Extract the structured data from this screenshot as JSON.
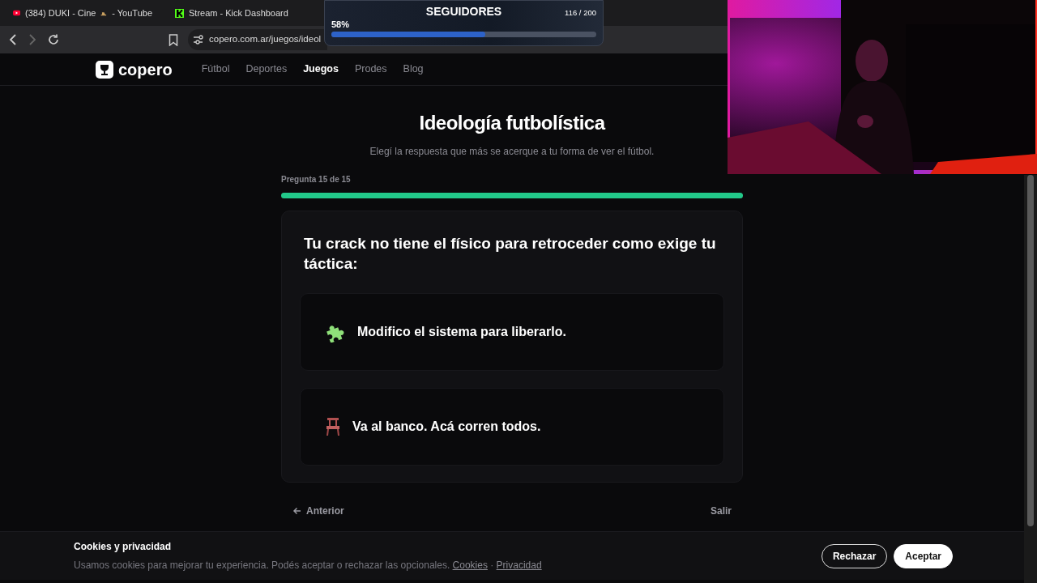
{
  "browser": {
    "tabs": [
      {
        "title": "(384) DUKI - Cine",
        "title_suffix": "- YouTube",
        "kind": "youtube",
        "selected": false
      },
      {
        "title": "Stream - Kick Dashboard",
        "kind": "kick",
        "selected": false
      }
    ],
    "address": "copero.com.ar/juegos/ideol"
  },
  "site": {
    "logo": "copero",
    "nav": [
      {
        "label": "Fútbol",
        "selected": false
      },
      {
        "label": "Deportes",
        "selected": false
      },
      {
        "label": "Juegos",
        "selected": true
      },
      {
        "label": "Prodes",
        "selected": false
      },
      {
        "label": "Blog",
        "selected": false
      }
    ]
  },
  "quiz": {
    "title": "Ideología futbolística",
    "subtitle": "Elegí la respuesta que más se acerque a tu forma de ver el fútbol.",
    "progress_label": "Pregunta 15 de 15",
    "level": 1.0,
    "question": "Tu crack no tiene el físico para retroceder como exige tu táctica:",
    "options": [
      {
        "text": "Modifico el sistema para liberarlo.",
        "kind": "puzzle"
      },
      {
        "text": "Va al banco. Acá corren todos.",
        "kind": "chair"
      }
    ],
    "back": "Anterior",
    "exit": "Salir"
  },
  "cookies": {
    "title": "Cookies y privacidad",
    "text": "Usamos cookies para mejorar tu experiencia. Podés aceptar o rechazar las opcionales.",
    "links": [
      "Cookies",
      "Privacidad"
    ],
    "separator": "·",
    "buttons": [
      {
        "label": "Rechazar",
        "kind": "outline"
      },
      {
        "label": "Aceptar",
        "kind": "solid"
      }
    ]
  },
  "followers_widget": {
    "title": "SEGUIDORES",
    "count": "116 / 200",
    "percent": "58%",
    "level": 0.58
  }
}
